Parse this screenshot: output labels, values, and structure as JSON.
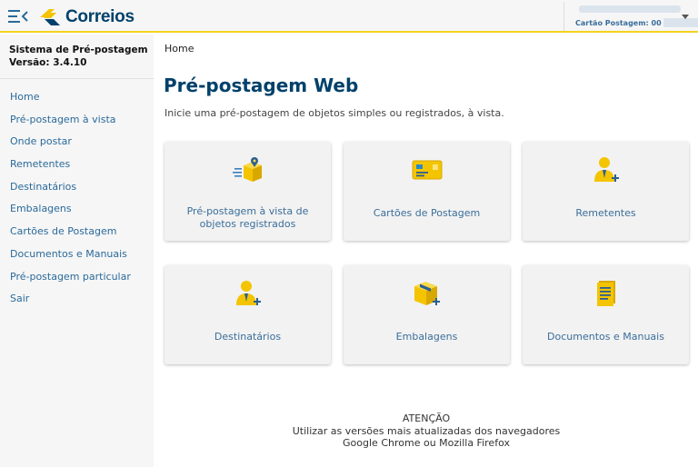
{
  "header": {
    "logo_text": "Correios",
    "cartao_label": "Cartão Postagem: 00"
  },
  "sidebar": {
    "system_name": "Sistema de Pré-postagem",
    "version": "Versão: 3.4.10",
    "items": [
      {
        "label": "Home"
      },
      {
        "label": "Pré-postagem à vista"
      },
      {
        "label": "Onde postar"
      },
      {
        "label": "Remetentes"
      },
      {
        "label": "Destinatários"
      },
      {
        "label": "Embalagens"
      },
      {
        "label": "Cartões de Postagem"
      },
      {
        "label": "Documentos e Manuais"
      },
      {
        "label": "Pré-postagem particular"
      },
      {
        "label": "Sair"
      }
    ]
  },
  "main": {
    "breadcrumb": "Home",
    "title": "Pré-postagem Web",
    "subtitle": "Inicie uma pré-postagem de objetos simples ou registrados, à vista.",
    "cards": [
      {
        "label": "Pré-postagem à vista de objetos registrados",
        "icon": "delivery-box-icon"
      },
      {
        "label": "Cartões de Postagem",
        "icon": "card-icon"
      },
      {
        "label": "Remetentes",
        "icon": "user-add-icon"
      },
      {
        "label": "Destinatários",
        "icon": "user-add-icon"
      },
      {
        "label": "Embalagens",
        "icon": "package-add-icon"
      },
      {
        "label": "Documentos e Manuais",
        "icon": "document-icon"
      }
    ]
  },
  "notice": {
    "line1": "ATENÇÃO",
    "line2": "Utilizar as versões mais atualizadas dos navegadores",
    "line3": "Google Chrome ou Mozilla Firefox"
  },
  "colors": {
    "brand_blue": "#00416b",
    "brand_yellow": "#f4d21f",
    "link_blue": "#2a6a9a"
  }
}
